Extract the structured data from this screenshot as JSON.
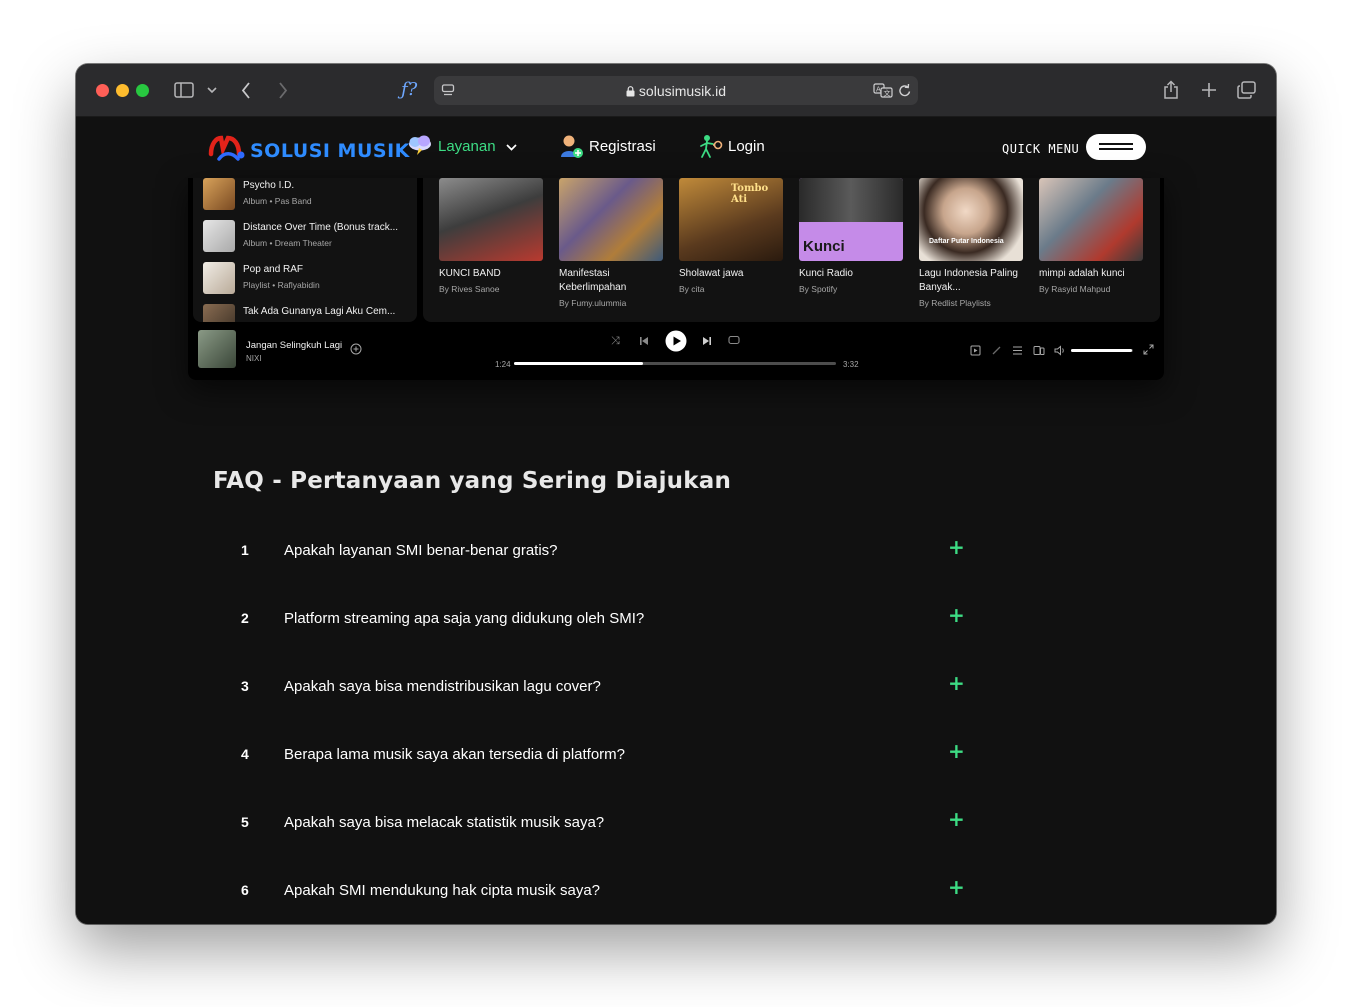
{
  "browser": {
    "url": "solusimusik.id",
    "reader_glyph": "ƒ?",
    "colors": {
      "close": "#ff5f57",
      "minimize": "#febc2e",
      "maximize": "#28c840"
    }
  },
  "nav": {
    "logo_text": "SOLUSI MUSIK",
    "items": [
      {
        "label": "Layanan",
        "color": "#3ddc84"
      },
      {
        "label": "Registrasi",
        "color": "#ffffff"
      },
      {
        "label": "Login",
        "color": "#ffffff"
      }
    ],
    "quick_menu": "QUICK MENU"
  },
  "player": {
    "library": [
      {
        "title": "Psycho I.D.",
        "subtitle": "Album • Pas Band",
        "color": "#b07a3a"
      },
      {
        "title": "Distance Over Time (Bonus track...",
        "subtitle": "Album • Dream Theater",
        "color": "#c9c9c9"
      },
      {
        "title": "Pop and RAF",
        "subtitle": "Playlist • Raflyabidin",
        "color": "#d9d4cc"
      },
      {
        "title": "Tak Ada Gunanya Lagi Aku Cem...",
        "subtitle": "",
        "color": "#5a4a3a"
      }
    ],
    "cards": [
      {
        "title": "KUNCI BAND",
        "subtitle": "By Rives Sanoe",
        "color": "#6b6b6b"
      },
      {
        "title": "Manifestasi Keberlimpahan",
        "subtitle": "By Fumy.ulummia",
        "color": "#8a6f4a"
      },
      {
        "title": "Sholawat jawa",
        "subtitle": "By cita",
        "color": "#7a5a34",
        "overlay": "Tombo Ati"
      },
      {
        "title": "Kunci Radio",
        "subtitle": "By Spotify",
        "color": "#c58be8",
        "overlay": "Kunci"
      },
      {
        "title": "Lagu Indonesia Paling Banyak...",
        "subtitle": "By Redlist Playlists",
        "color": "#d8d0c6",
        "overlay": "Daftar Putar Indonesia"
      },
      {
        "title": "mimpi adalah kunci",
        "subtitle": "By Rasyid Mahpud",
        "color": "#9aa3ab"
      }
    ],
    "now_playing": {
      "title": "Jangan Selingkuh Lagi",
      "artist": "NIXI",
      "color": "#5c6e5a"
    },
    "elapsed": "1:24",
    "duration": "3:32",
    "progress": 0.4,
    "volume": 0.98
  },
  "faq": {
    "title": "FAQ - Pertanyaan yang Sering Diajukan",
    "items": [
      {
        "num": "1",
        "question": "Apakah layanan SMI benar-benar gratis?"
      },
      {
        "num": "2",
        "question": "Platform streaming apa saja yang didukung oleh SMI?"
      },
      {
        "num": "3",
        "question": "Apakah saya bisa mendistribusikan lagu cover?"
      },
      {
        "num": "4",
        "question": "Berapa lama musik saya akan tersedia di platform?"
      },
      {
        "num": "5",
        "question": "Apakah saya bisa melacak statistik musik saya?"
      },
      {
        "num": "6",
        "question": "Apakah SMI mendukung hak cipta musik saya?"
      }
    ],
    "expand_glyph": "+"
  }
}
